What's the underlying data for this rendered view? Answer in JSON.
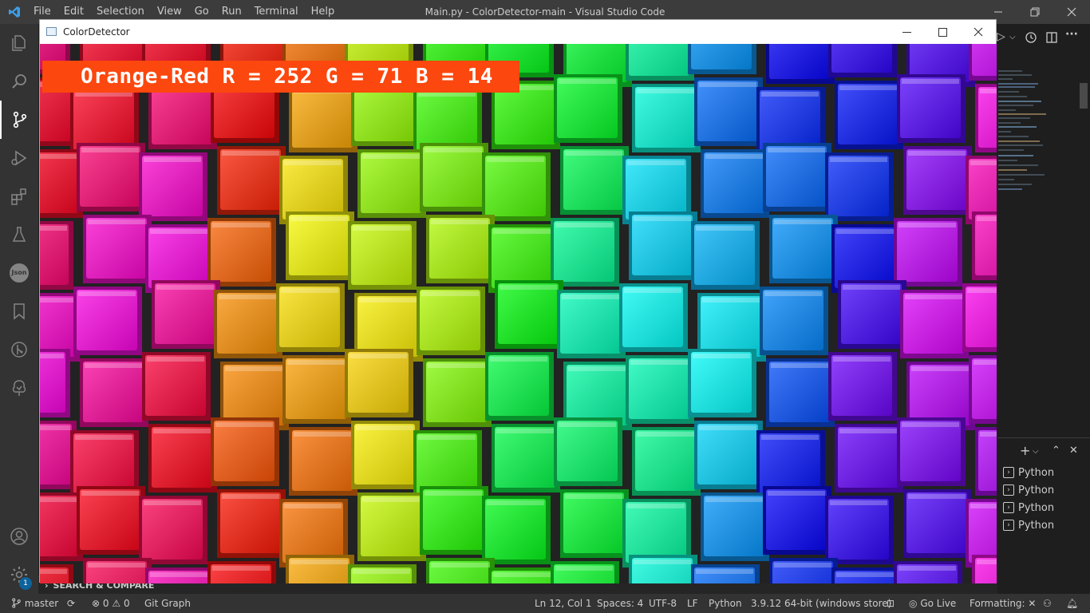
{
  "vscode": {
    "menu": [
      "File",
      "Edit",
      "Selection",
      "View",
      "Go",
      "Run",
      "Terminal",
      "Help"
    ],
    "window_title": "Main.py - ColorDetector-main - Visual Studio Code",
    "outline_section": "SEARCH & COMPARE",
    "terminal_items": [
      "Python",
      "Python",
      "Python",
      "Python"
    ],
    "settings_badge": "1",
    "json_icon_label": "Json",
    "status": {
      "branch": "master",
      "errors": "0",
      "warnings": "0",
      "git_graph": "Git Graph",
      "position": "Ln 12, Col 1",
      "spaces": "Spaces: 4",
      "encoding": "UTF-8",
      "eol": "LF",
      "language": "Python",
      "interpreter": "3.9.12 64-bit (windows store)",
      "go_live": "Go Live",
      "formatting": "Formatting: ✕"
    }
  },
  "color_detector": {
    "title": "ColorDetector",
    "detected": {
      "name": "Orange-Red",
      "r": 252,
      "g": 71,
      "b": 14,
      "label": "Orange-Red R = 252 G = 71 B = 14",
      "color_hex": "#fc470e"
    }
  },
  "colors": {
    "accent": "#0e639c",
    "statusbar": "#333333",
    "activitybar": "#333333",
    "titlebar": "#3c3c3c"
  }
}
